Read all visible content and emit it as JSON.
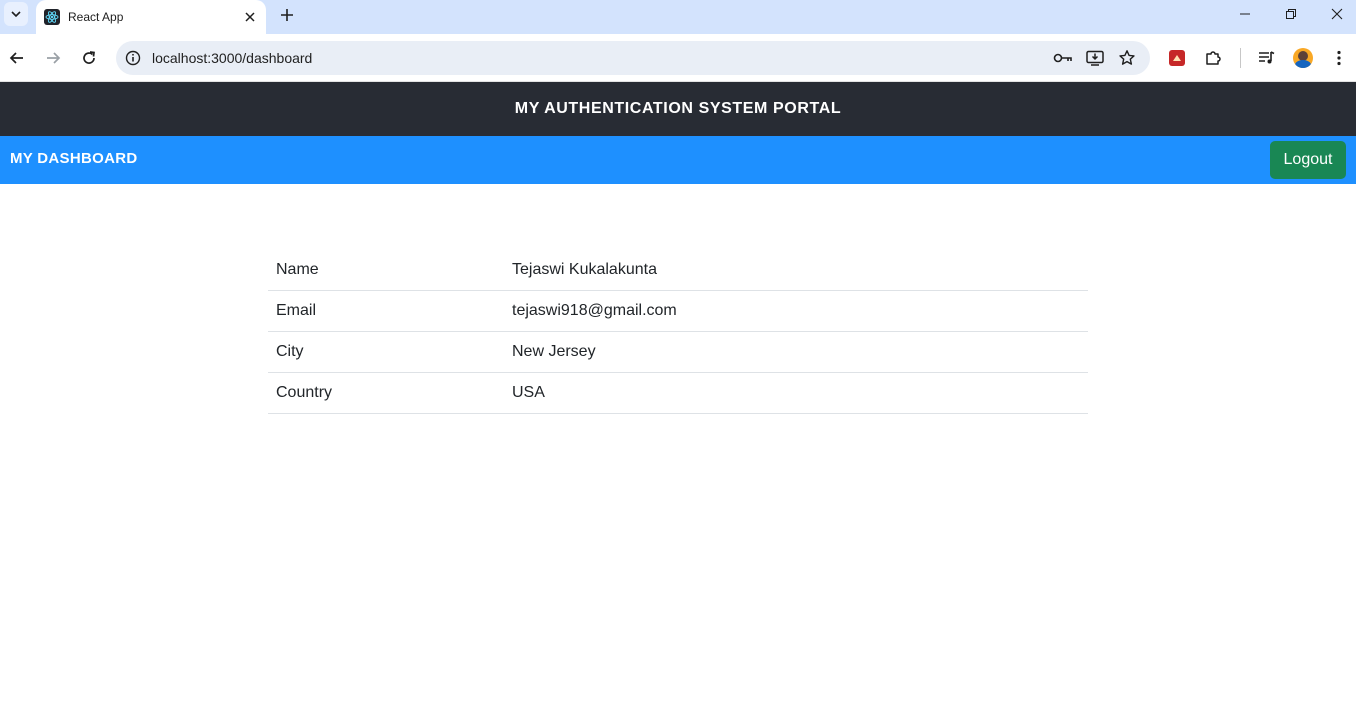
{
  "browser": {
    "tab_title": "React App",
    "url": "localhost:3000/dashboard"
  },
  "header": {
    "title": "MY AUTHENTICATION SYSTEM PORTAL"
  },
  "navbar": {
    "brand": "MY DASHBOARD",
    "logout_label": "Logout",
    "logout_color": "#198754",
    "bar_color": "#1e90ff"
  },
  "profile": {
    "rows": [
      {
        "label": "Name",
        "value": "Tejaswi Kukalakunta"
      },
      {
        "label": "Email",
        "value": "tejaswi918@gmail.com"
      },
      {
        "label": "City",
        "value": "New Jersey"
      },
      {
        "label": "Country",
        "value": "USA"
      }
    ]
  },
  "icons": [
    "tab-search-icon",
    "react-favicon-icon",
    "close-icon",
    "plus-icon",
    "minimize-icon",
    "restore-icon",
    "back-icon",
    "forward-icon",
    "reload-icon",
    "info-icon",
    "password-key-icon",
    "install-app-icon",
    "bookmark-star-icon",
    "extension-icon",
    "puzzle-icon",
    "media-queue-icon",
    "profile-avatar-icon",
    "more-menu-icon"
  ]
}
